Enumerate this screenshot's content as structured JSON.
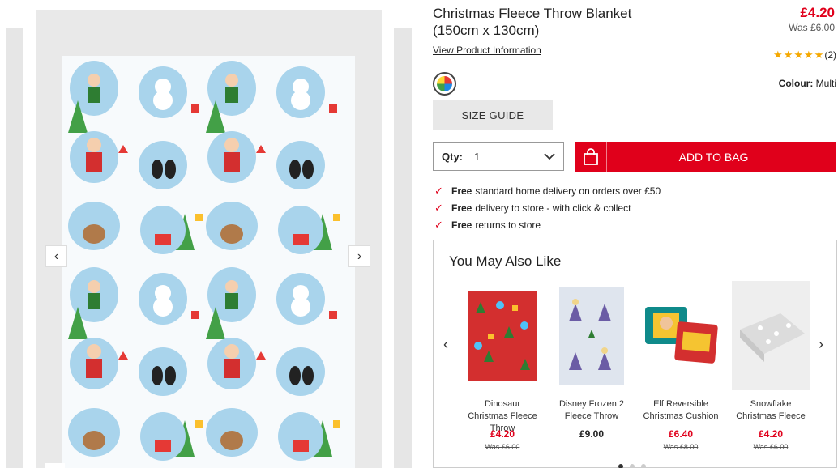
{
  "product": {
    "title": "Christmas Fleece Throw Blanket (150cm x 130cm)",
    "price": "£4.20",
    "was_price": "Was £6.00",
    "view_info": "View Product Information",
    "rating_count": "(2)",
    "rating": 5,
    "colour_label": "Colour:",
    "colour_value": "Multi"
  },
  "actions": {
    "size_guide": "SIZE GUIDE",
    "qty_label": "Qty:",
    "qty_value": "1",
    "add_to_bag": "ADD TO BAG"
  },
  "benefits": [
    {
      "strong": "Free",
      "text": "standard home delivery on orders over £50"
    },
    {
      "strong": "Free",
      "text": "delivery to store - with click & collect"
    },
    {
      "strong": "Free",
      "text": "returns to store"
    }
  ],
  "ymal": {
    "title": "You May Also Like",
    "items": [
      {
        "name": "Dinosaur Christmas Fleece Throw",
        "price": "£4.20",
        "was": "Was £6.00",
        "sale": true
      },
      {
        "name": "Disney Frozen 2 Fleece Throw",
        "price": "£9.00",
        "was": "",
        "sale": false
      },
      {
        "name": "Elf Reversible Christmas Cushion",
        "price": "£6.40",
        "was": "Was £8.00",
        "sale": true
      },
      {
        "name": "Snowflake Christmas Fleece",
        "price": "£4.20",
        "was": "Was £6.00",
        "sale": true
      }
    ]
  },
  "colors": {
    "accent": "#e0001b",
    "star": "#f5a800"
  }
}
